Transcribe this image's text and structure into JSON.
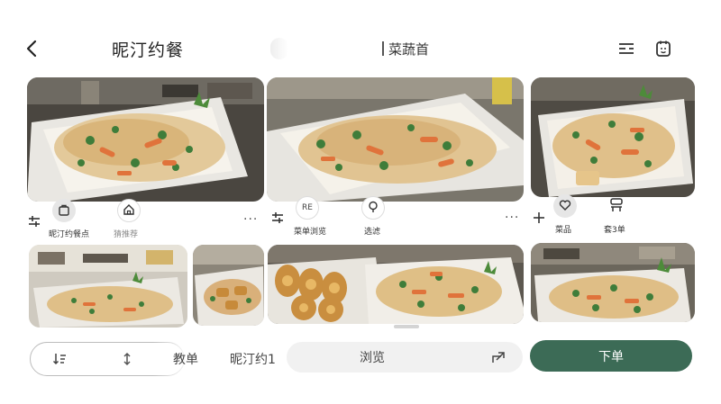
{
  "header": {
    "back_icon": "chevron-left-icon",
    "title": "昵汀约餐",
    "center_title": "菜蔬首",
    "icons": [
      "menu-lines-icon",
      "calendar-face-icon"
    ]
  },
  "cards_row1": {
    "card1_actions": {
      "label_1": "昵汀约餐点",
      "label_2": "猜推荐"
    },
    "card2_actions": {
      "chip_text": "RE",
      "label_1": "菜单浏览",
      "label_2": "选滤"
    },
    "card3_actions": {
      "label_1": "菜品",
      "label_2": "套3单"
    }
  },
  "bottom": {
    "label_1": "教单",
    "label_2": "昵汀约1",
    "browse": "浏览",
    "order": "下单"
  },
  "colors": {
    "accent": "#3c6b56",
    "chip_bg": "#e6e6e6",
    "browse_bg": "#f1f1f1"
  }
}
